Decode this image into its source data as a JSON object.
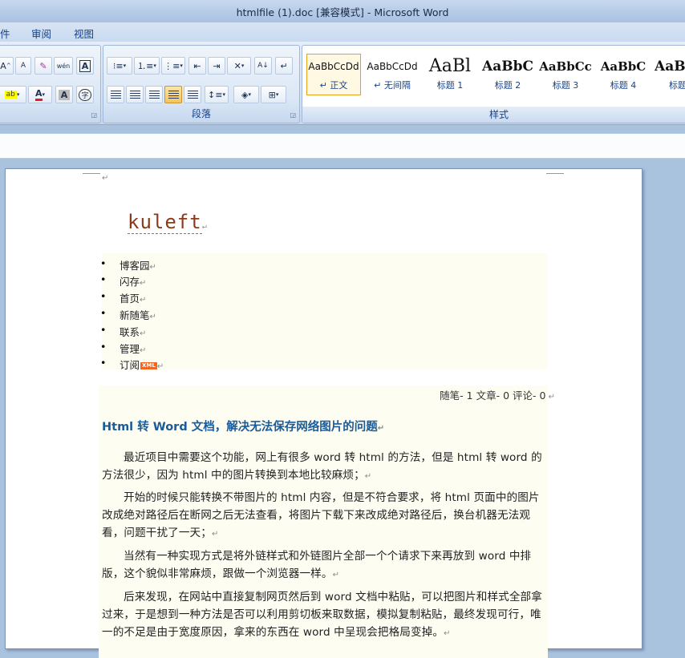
{
  "window": {
    "title": "htmlfile (1).doc [兼容模式] - Microsoft Word"
  },
  "menu": {
    "tabs": [
      "件",
      "审阅",
      "视图"
    ]
  },
  "ribbon": {
    "font_group": {
      "grow_label": "A",
      "shrink_label": "A",
      "phonetic_label": "wén",
      "text_label": "A"
    },
    "paragraph_group": {
      "label": "段落"
    },
    "styles_group": {
      "label": "样式",
      "items": [
        {
          "sample": "AaBbCcDd",
          "name": "↵ 正文"
        },
        {
          "sample": "AaBbCcDd",
          "name": "↵ 无间隔"
        },
        {
          "sample": "AaBl",
          "name": "标题 1"
        },
        {
          "sample": "AaBbC",
          "name": "标题 2"
        },
        {
          "sample": "AaBbCc",
          "name": "标题 3"
        },
        {
          "sample": "AaBbC",
          "name": "标题 4"
        },
        {
          "sample": "AaB",
          "name": "标题"
        }
      ]
    }
  },
  "document": {
    "site_title": "kuleft",
    "nav_items": [
      "博客园",
      "闪存",
      "首页",
      "新随笔",
      "联系",
      "管理",
      "订阅"
    ],
    "xml_badge": "XML",
    "stats": "随笔- 1 文章- 0 评论- 0",
    "post_title": "Html 转 Word 文档，解决无法保存网络图片的问题",
    "paragraphs": [
      "最近项目中需要这个功能，网上有很多 word 转 html 的方法，但是 html 转 word 的方法很少，因为 html 中的图片转换到本地比较麻烦；",
      "开始的时候只能转换不带图片的 html 内容，但是不符合要求，将 html 页面中的图片改成绝对路径后在断网之后无法查看，将图片下载下来改成绝对路径后，换台机器无法观看，问题干扰了一天；",
      "当然有一种实现方式是将外链样式和外链图片全部一个个请求下来再放到 word 中排版，这个貌似非常麻烦，跟做一个浏览器一样。",
      "后来发现，在网站中直接复制网页然后到 word 文档中粘贴，可以把图片和样式全部拿过来，于是想到一种方法是否可以利用剪切板来取数据，模拟复制粘贴，最终发现可行，唯一的不足是由于宽度原因，拿来的东西在 word 中呈现会把格局变掉。"
    ]
  }
}
